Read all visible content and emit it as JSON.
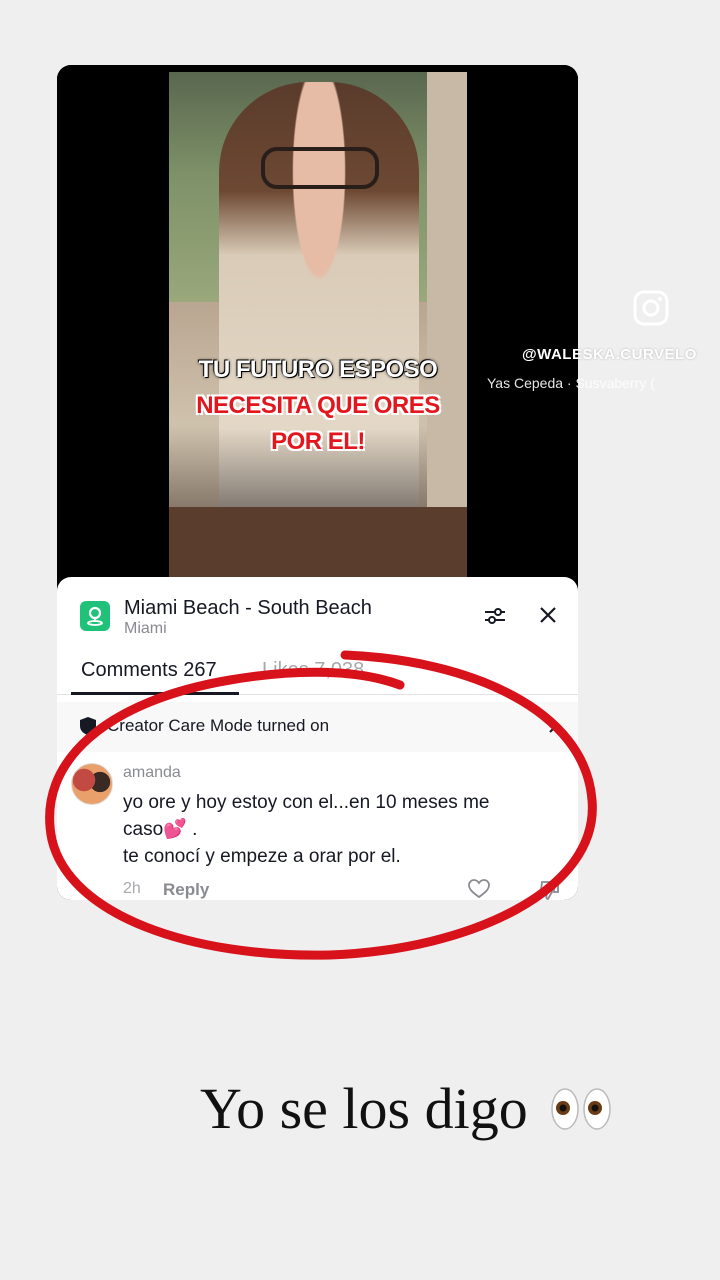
{
  "video": {
    "caption": {
      "line1": "TU FUTURO ESPOSO",
      "line2": "NECESITA QUE ORES",
      "line3": "POR EL!"
    }
  },
  "overlay": {
    "handle": "@WALESKA.CURVELO",
    "music": "Yas Cepeda · Susvaberry (",
    "icon": "instagram-icon"
  },
  "sheet": {
    "location_title": "Miami Beach - South Beach",
    "location_subtitle": "Miami",
    "tabs": {
      "comments": "Comments 267",
      "likes": "Likes 7,038"
    },
    "care_mode": "Creator Care Mode turned on",
    "comment": {
      "user": "amanda",
      "line1": "yo ore y hoy estoy con el...en 10 meses me",
      "line2": "caso💕 .",
      "line3": "te conocí y empeze a orar por el.",
      "time": "2h",
      "reply": "Reply"
    }
  },
  "story_text": "Yo se los digo",
  "colors": {
    "caption_red": "#e3161e",
    "location_green": "#1fc278",
    "annotation_red": "#d8121b"
  }
}
